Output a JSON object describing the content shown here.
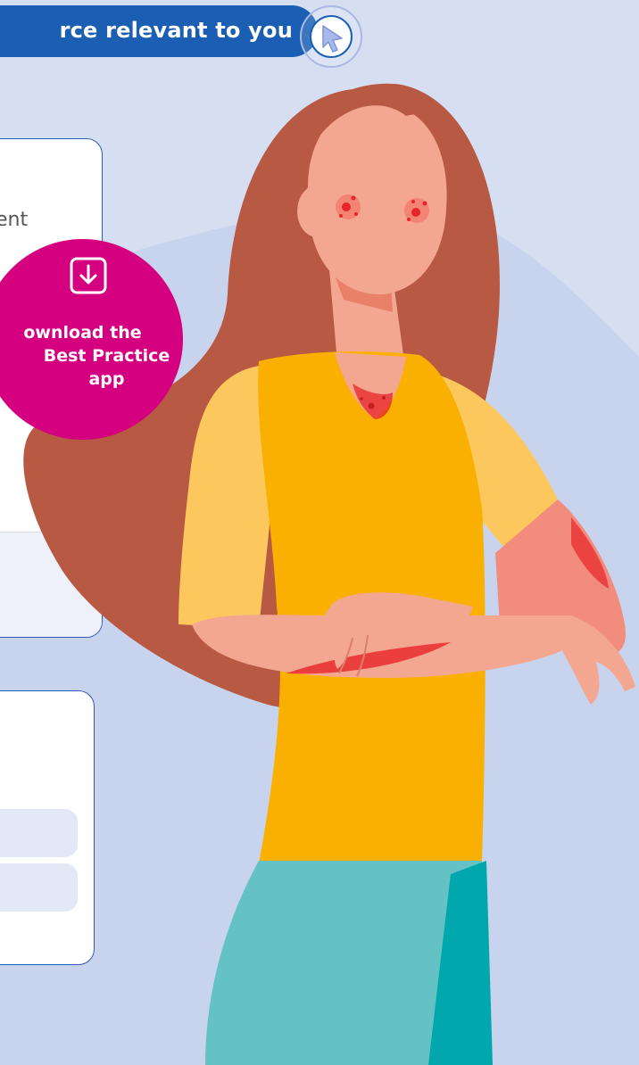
{
  "banner": {
    "text": "rce relevant to you",
    "color": "#1a5fb4"
  },
  "cursor_button": {
    "icon": "cursor-arrow-icon"
  },
  "card1": {
    "text": "ent"
  },
  "download_badge": {
    "line1": "ownload the",
    "line2": "Best Practice",
    "line3": "app",
    "color": "#d5007f",
    "icon": "download-icon"
  },
  "colors": {
    "background": "#d6def2",
    "hair": "#b85a43",
    "skin": "#f4a790",
    "shirt": "#f9b000",
    "pants": "#64c1c4",
    "rash": "#e8242a"
  }
}
